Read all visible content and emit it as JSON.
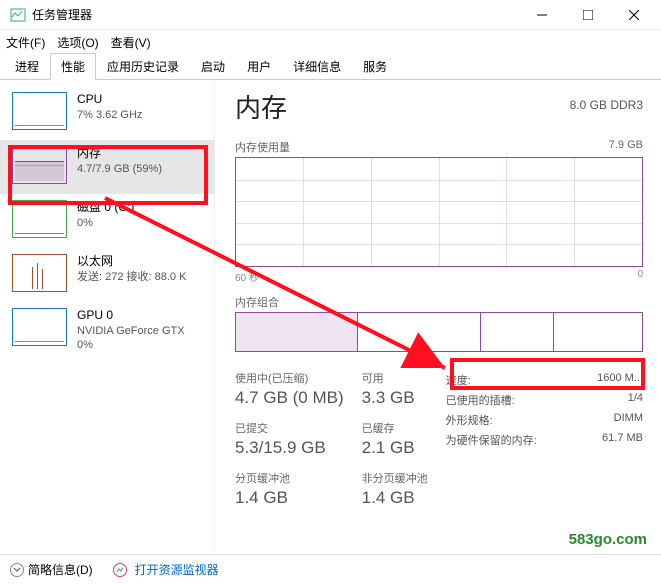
{
  "window": {
    "title": "任务管理器"
  },
  "menu": {
    "file": "文件(F)",
    "options": "选项(O)",
    "view": "查看(V)"
  },
  "tabs": [
    "进程",
    "性能",
    "应用历史记录",
    "启动",
    "用户",
    "详细信息",
    "服务"
  ],
  "sidebar": [
    {
      "name": "CPU",
      "detail": "7% 3.62 GHz"
    },
    {
      "name": "内存",
      "detail": "4.7/7.9 GB (59%)"
    },
    {
      "name": "磁盘 0 (C:)",
      "detail": "0%"
    },
    {
      "name": "以太网",
      "detail": "发送: 272 接收: 88.0 K"
    },
    {
      "name": "GPU 0",
      "detail": "NVIDIA GeForce GTX\n0%"
    }
  ],
  "main": {
    "title": "内存",
    "subtitle": "8.0 GB DDR3",
    "usage_label": "内存使用量",
    "usage_max": "7.9 GB",
    "axis_left": "60 秒",
    "axis_right": "0",
    "comp_label": "内存组合"
  },
  "stats": {
    "in_use_label": "使用中(已压缩)",
    "in_use": "4.7 GB (0 MB)",
    "avail_label": "可用",
    "avail": "3.3 GB",
    "commit_label": "已提交",
    "commit": "5.3/15.9 GB",
    "cached_label": "已缓存",
    "cached": "2.1 GB",
    "paged_label": "分页缓冲池",
    "paged": "1.4 GB",
    "nonpaged_label": "非分页缓冲池",
    "nonpaged": "1.4 GB"
  },
  "details": {
    "speed_label": "速度:",
    "speed": "1600 M...",
    "slots_label": "已使用的插槽:",
    "slots": "1/4",
    "form_label": "外形规格:",
    "form": "DIMM",
    "reserved_label": "为硬件保留的内存:",
    "reserved": "61.7 MB"
  },
  "footer": {
    "brief": "简略信息(D)",
    "resmon": "打开资源监视器"
  },
  "watermark": "583go.com"
}
